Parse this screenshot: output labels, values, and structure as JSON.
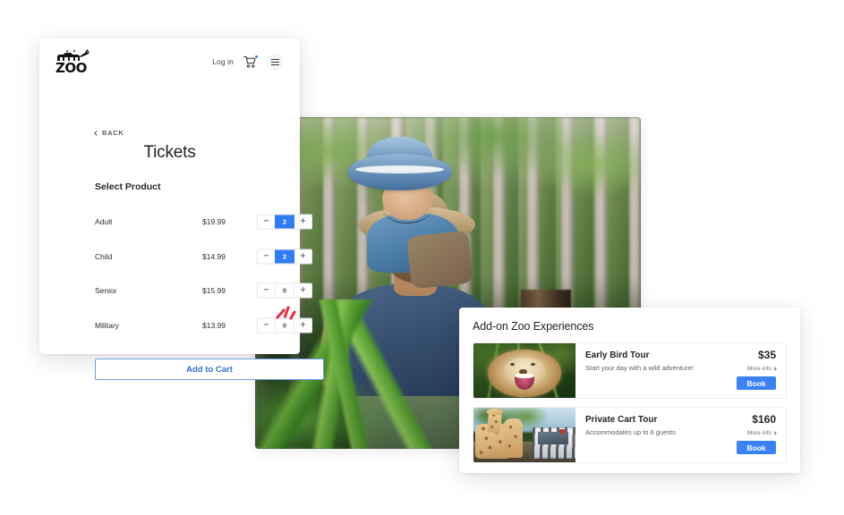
{
  "ticket_panel": {
    "logo": {
      "word": "ZOO",
      "icon": "zoo-animal-silhouette"
    },
    "header": {
      "login_label": "Log in",
      "cart_icon": "shopping-cart-icon",
      "menu_icon": "hamburger-menu-icon"
    },
    "back_label": "BACK",
    "title": "Tickets",
    "section_label": "Select Product",
    "products": [
      {
        "name": "Adult",
        "price": "$19.99",
        "qty": "2",
        "active": true
      },
      {
        "name": "Child",
        "price": "$14.99",
        "qty": "2",
        "active": true
      },
      {
        "name": "Senior",
        "price": "$15.99",
        "qty": "0",
        "active": false
      },
      {
        "name": "Military",
        "price": "$13.99",
        "qty": "0",
        "active": false
      }
    ],
    "stepper": {
      "minus": "−",
      "plus": "+"
    },
    "add_to_cart_label": "Add to Cart"
  },
  "addon_panel": {
    "title": "Add-on Zoo Experiences",
    "cards": [
      {
        "name": "Early Bird Tour",
        "description": "Start your day with a wild adventure!",
        "price": "$35",
        "more_info_label": "More info",
        "book_label": "Book",
        "thumb": "lion-roaring-photo"
      },
      {
        "name": "Private Cart Tour",
        "description": "Accommodates up to 6 guests",
        "price": "$160",
        "more_info_label": "More info",
        "book_label": "Book",
        "thumb": "giraffes-and-tour-cart-photo"
      }
    ]
  },
  "hero": {
    "alt": "father-carrying-child-on-shoulders-at-zoo-photo"
  },
  "colors": {
    "accent_blue": "#3b82f6",
    "stepper_blue": "#2f7cf6",
    "outline_blue": "#6d9fe8",
    "link_blue": "#2f6fd0",
    "spark_red": "#e8304f",
    "text_dark": "#1f2123",
    "text_muted": "#5b6066",
    "panel_white": "#ffffff",
    "border_light": "#eceef1"
  }
}
